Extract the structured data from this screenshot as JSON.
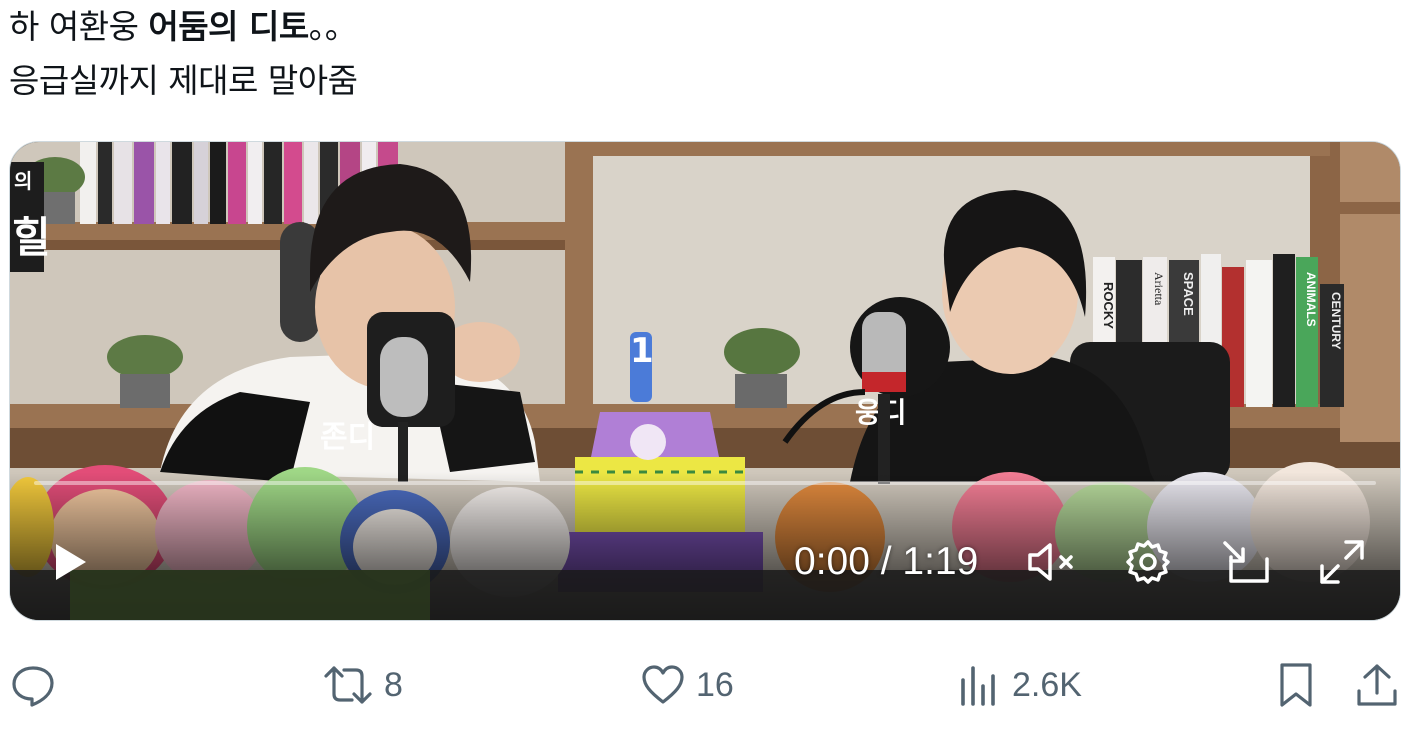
{
  "tweet": {
    "line1_normal": "하 여환웅 ",
    "line1_bold": "어둠의 디토",
    "line1_end": "。。",
    "line2": "응급실까지 제대로 말아줌"
  },
  "video": {
    "time_display": "0:00 / 1:19",
    "progress_fraction": 0,
    "sign_left": "존디",
    "sign_right": "웅디",
    "cake_number": "1",
    "book_labels": [
      "ROCKY",
      "Arietta",
      "SPACE",
      "ANIMALS",
      "CENTURY"
    ],
    "controls": {
      "play_icon": "play-icon",
      "mute_icon": "volume-muted-icon",
      "settings_icon": "gear-icon",
      "pip_icon": "picture-in-picture-icon",
      "fullscreen_icon": "fullscreen-icon"
    }
  },
  "actions": {
    "reply_count": "",
    "retweet_count": "8",
    "like_count": "16",
    "views_count": "2.6K"
  },
  "colors": {
    "text": "#0f1419",
    "secondary": "#536471",
    "border": "#cfd9de",
    "video_bg": "#3b352e"
  }
}
